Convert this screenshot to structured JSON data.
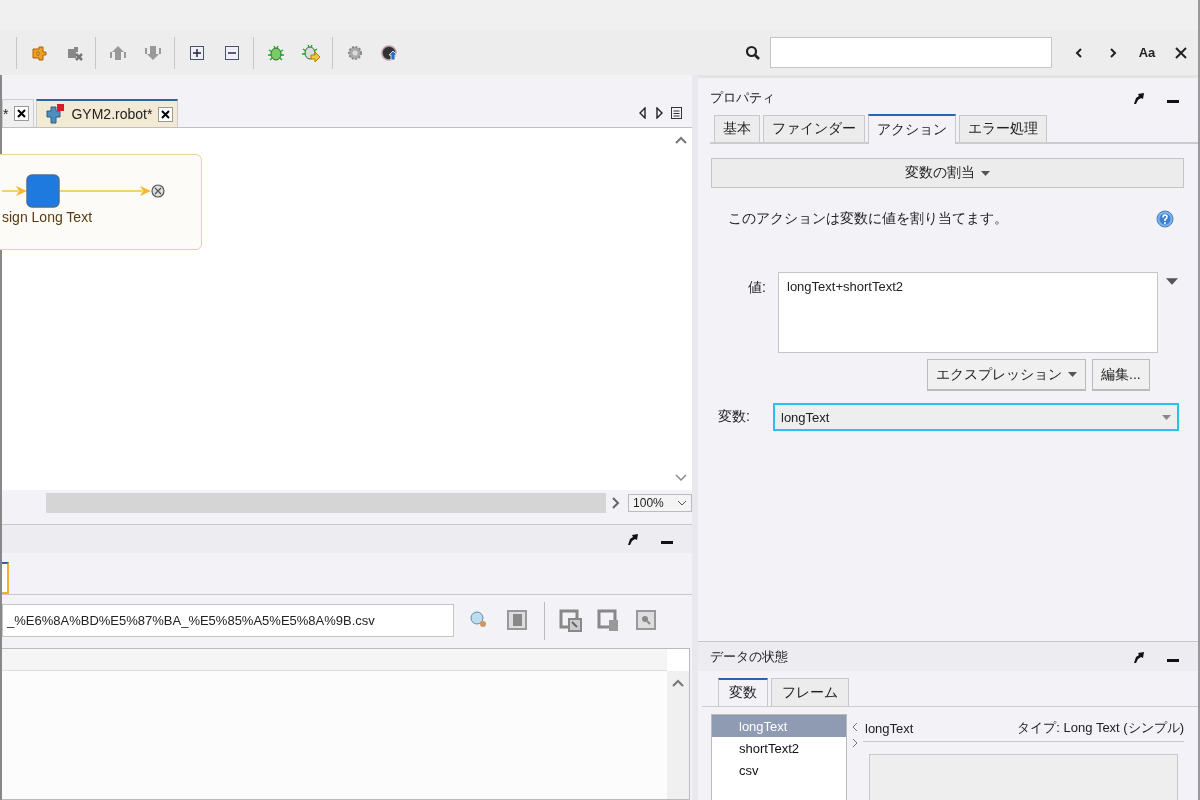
{
  "find_bar": {
    "match_case_label": "Aa"
  },
  "editor": {
    "tabs": [
      {
        "label": "*",
        "selected": false
      },
      {
        "label": "GYM2.robot*",
        "selected": true
      }
    ],
    "flow": {
      "step_label": "sign Long Text"
    },
    "zoom": "100%"
  },
  "bottom_panel": {
    "path_value": "_%E6%8A%BD%E5%87%BA_%E5%85%A5%E5%8A%9B.csv"
  },
  "properties": {
    "title": "プロパティ",
    "tabs": [
      {
        "label": "基本",
        "selected": false
      },
      {
        "label": "ファインダー",
        "selected": false
      },
      {
        "label": "アクション",
        "selected": true
      },
      {
        "label": "エラー処理",
        "selected": false
      }
    ],
    "action_button": "変数の割当",
    "description": "このアクションは変数に値を割り当てます。",
    "value_label": "値:",
    "value": "longText+shortText2",
    "expression_button": "エクスプレッション",
    "edit_button": "編集...",
    "variable_label": "変数:",
    "variable_value": "longText"
  },
  "data_state": {
    "title": "データの状態",
    "tabs": [
      {
        "label": "変数",
        "selected": true
      },
      {
        "label": "フレーム",
        "selected": false
      }
    ],
    "variables": [
      {
        "name": "longText",
        "selected": true
      },
      {
        "name": "shortText2",
        "selected": false
      },
      {
        "name": "csv",
        "selected": false
      }
    ],
    "detail_name": "longText",
    "detail_type": "タイプ: Long Text (シンプル)"
  }
}
